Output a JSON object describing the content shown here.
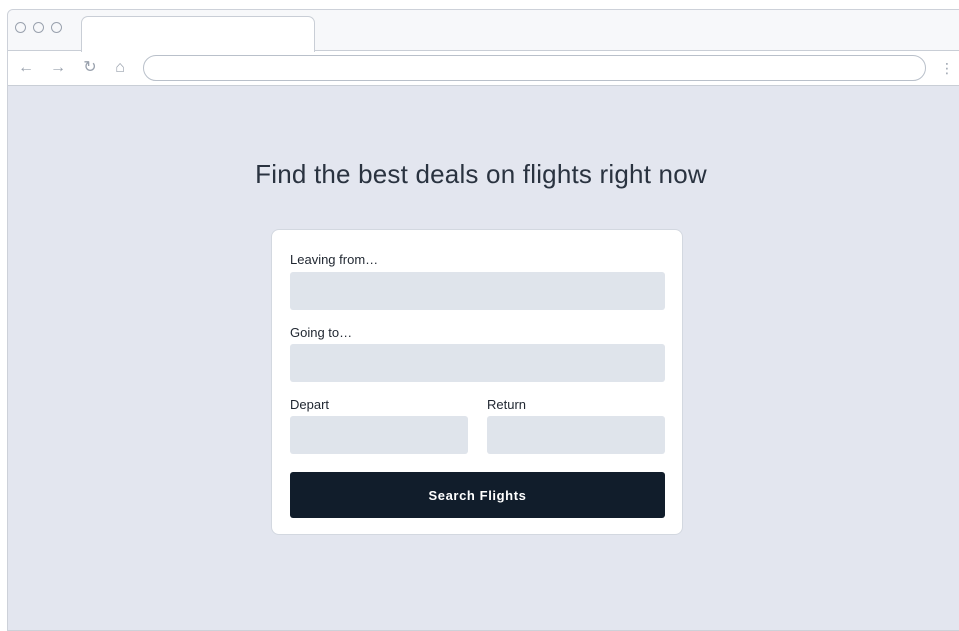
{
  "browser": {
    "controls": {
      "back_glyph": "←",
      "forward_glyph": "→",
      "reload_glyph": "↻",
      "home_glyph": "⌂",
      "menu_glyph": "⋮"
    },
    "address": {
      "value": "",
      "placeholder": ""
    }
  },
  "page": {
    "headline": "Find the best deals on flights right now",
    "form": {
      "leaving_from_label": "Leaving from…",
      "leaving_from_value": "",
      "going_to_label": "Going to…",
      "going_to_value": "",
      "depart_label": "Depart",
      "depart_value": "",
      "return_label": "Return",
      "return_value": "",
      "submit_label": "Search Flights"
    }
  },
  "colors": {
    "page_background": "#e3e6ef",
    "card_background": "#ffffff",
    "input_background": "#dfe4eb",
    "button_background": "#111d2b",
    "button_text": "#ffffff",
    "chrome_icon": "#9aa2ae"
  }
}
